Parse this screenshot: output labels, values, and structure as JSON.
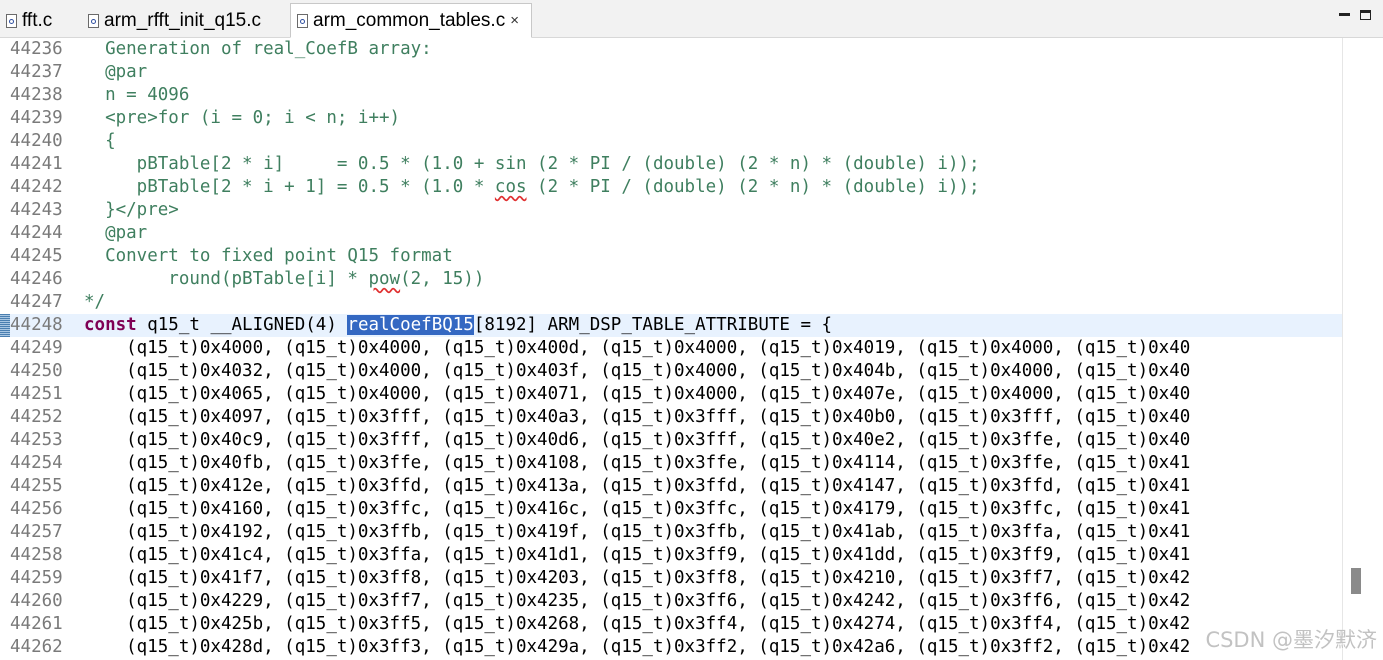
{
  "tabs": [
    {
      "label": "fft.c",
      "active": false
    },
    {
      "label": "arm_rfft_init_q15.c",
      "active": false
    },
    {
      "label": "arm_common_tables.c",
      "active": true
    }
  ],
  "tab_close_glyph": "×",
  "editor": {
    "lines": [
      {
        "num": "44236",
        "text": "  Generation of real_CoefB array:"
      },
      {
        "num": "44237",
        "text": "  @par"
      },
      {
        "num": "44238",
        "text": "  n = 4096"
      },
      {
        "num": "44239",
        "text": "  <pre>for (i = 0; i < n; i++)"
      },
      {
        "num": "44240",
        "text": "  {"
      },
      {
        "num": "44241",
        "text": "     pBTable[2 * i]     = 0.5 * (1.0 + sin (2 * PI / (double) (2 * n) * (double) i));"
      },
      {
        "num": "44242",
        "text": "     pBTable[2 * i + 1] = 0.5 * (1.0 * cos (2 * PI / (double) (2 * n) * (double) i));"
      },
      {
        "num": "44243",
        "text": "  }</pre>"
      },
      {
        "num": "44244",
        "text": "  @par"
      },
      {
        "num": "44245",
        "text": "  Convert to fixed point Q15 format"
      },
      {
        "num": "44246",
        "text": "        round(pBTable[i] * pow(2, 15))"
      },
      {
        "num": "44247",
        "text": "*/"
      },
      {
        "num": "44248",
        "keyword": "const",
        "before": " q15_t __ALIGNED(4) ",
        "selected": "realCoefBQ15",
        "after": "[8192] ARM_DSP_TABLE_ATTRIBUTE = {"
      },
      {
        "num": "44249",
        "text": "    (q15_t)0x4000, (q15_t)0x4000, (q15_t)0x400d, (q15_t)0x4000, (q15_t)0x4019, (q15_t)0x4000, (q15_t)0x40"
      },
      {
        "num": "44250",
        "text": "    (q15_t)0x4032, (q15_t)0x4000, (q15_t)0x403f, (q15_t)0x4000, (q15_t)0x404b, (q15_t)0x4000, (q15_t)0x40"
      },
      {
        "num": "44251",
        "text": "    (q15_t)0x4065, (q15_t)0x4000, (q15_t)0x4071, (q15_t)0x4000, (q15_t)0x407e, (q15_t)0x4000, (q15_t)0x40"
      },
      {
        "num": "44252",
        "text": "    (q15_t)0x4097, (q15_t)0x3fff, (q15_t)0x40a3, (q15_t)0x3fff, (q15_t)0x40b0, (q15_t)0x3fff, (q15_t)0x40"
      },
      {
        "num": "44253",
        "text": "    (q15_t)0x40c9, (q15_t)0x3fff, (q15_t)0x40d6, (q15_t)0x3fff, (q15_t)0x40e2, (q15_t)0x3ffe, (q15_t)0x40"
      },
      {
        "num": "44254",
        "text": "    (q15_t)0x40fb, (q15_t)0x3ffe, (q15_t)0x4108, (q15_t)0x3ffe, (q15_t)0x4114, (q15_t)0x3ffe, (q15_t)0x41"
      },
      {
        "num": "44255",
        "text": "    (q15_t)0x412e, (q15_t)0x3ffd, (q15_t)0x413a, (q15_t)0x3ffd, (q15_t)0x4147, (q15_t)0x3ffd, (q15_t)0x41"
      },
      {
        "num": "44256",
        "text": "    (q15_t)0x4160, (q15_t)0x3ffc, (q15_t)0x416c, (q15_t)0x3ffc, (q15_t)0x4179, (q15_t)0x3ffc, (q15_t)0x41"
      },
      {
        "num": "44257",
        "text": "    (q15_t)0x4192, (q15_t)0x3ffb, (q15_t)0x419f, (q15_t)0x3ffb, (q15_t)0x41ab, (q15_t)0x3ffa, (q15_t)0x41"
      },
      {
        "num": "44258",
        "text": "    (q15_t)0x41c4, (q15_t)0x3ffa, (q15_t)0x41d1, (q15_t)0x3ff9, (q15_t)0x41dd, (q15_t)0x3ff9, (q15_t)0x41"
      },
      {
        "num": "44259",
        "text": "    (q15_t)0x41f7, (q15_t)0x3ff8, (q15_t)0x4203, (q15_t)0x3ff8, (q15_t)0x4210, (q15_t)0x3ff7, (q15_t)0x42"
      },
      {
        "num": "44260",
        "text": "    (q15_t)0x4229, (q15_t)0x3ff7, (q15_t)0x4235, (q15_t)0x3ff6, (q15_t)0x4242, (q15_t)0x3ff6, (q15_t)0x42"
      },
      {
        "num": "44261",
        "text": "    (q15_t)0x425b, (q15_t)0x3ff5, (q15_t)0x4268, (q15_t)0x3ff4, (q15_t)0x4274, (q15_t)0x3ff4, (q15_t)0x42"
      },
      {
        "num": "44262",
        "text": "    (q15_t)0x428d, (q15_t)0x3ff3, (q15_t)0x429a, (q15_t)0x3ff2, (q15_t)0x42a6, (q15_t)0x3ff2, (q15_t)0x42"
      }
    ]
  },
  "watermark": "CSDN @墨汐默济",
  "colors": {
    "comment": "#3f7f5f",
    "keyword": "#7f0055",
    "selection": "#3468c2",
    "current_line": "#e8f2fe",
    "line_number": "#7a7a7a"
  }
}
